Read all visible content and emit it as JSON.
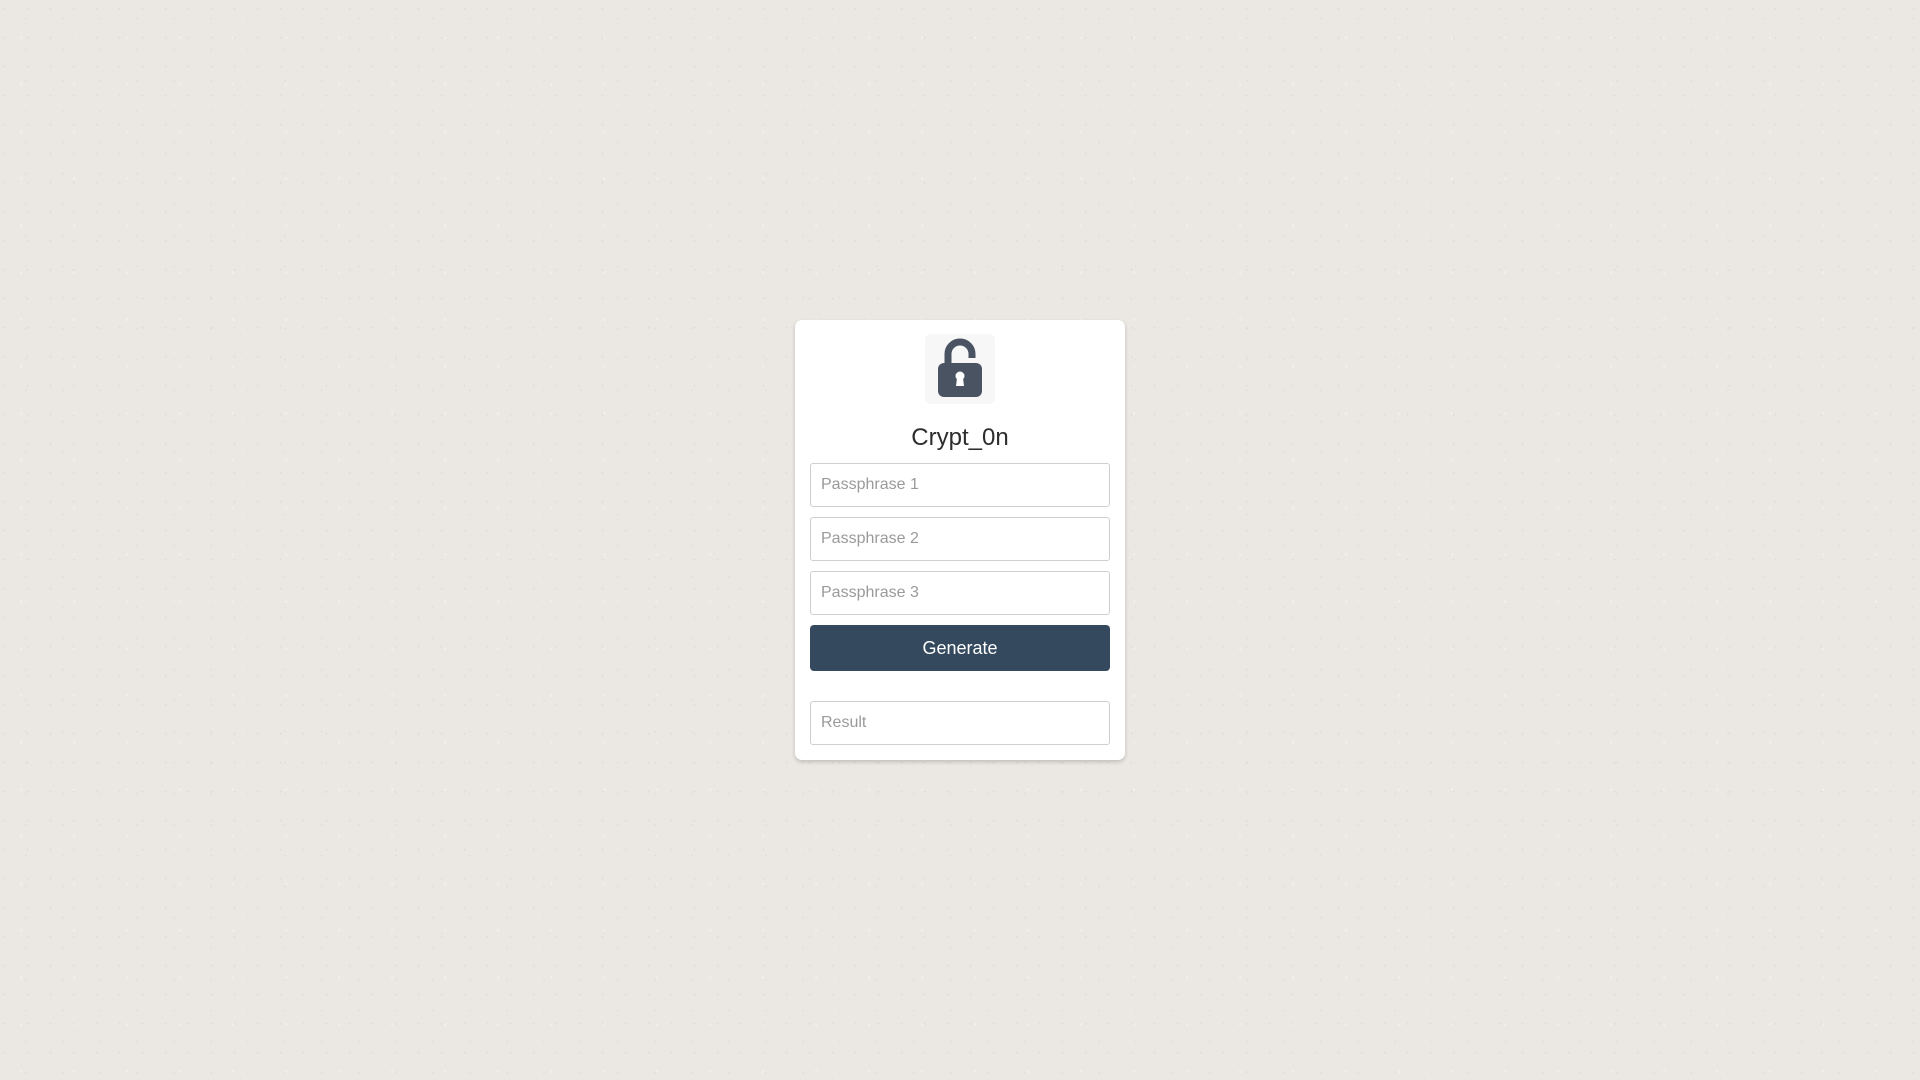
{
  "app": {
    "title": "Crypt_0n",
    "logo_icon": "unlocked-padlock-icon"
  },
  "form": {
    "passphrase1_placeholder": "Passphrase 1",
    "passphrase1_value": "",
    "passphrase2_placeholder": "Passphrase 2",
    "passphrase2_value": "",
    "passphrase3_placeholder": "Passphrase 3",
    "passphrase3_value": "",
    "generate_label": "Generate",
    "result_placeholder": "Result",
    "result_value": ""
  },
  "colors": {
    "background": "#ebe7e3",
    "card": "#ffffff",
    "button": "#34495e",
    "button_text": "#ffffff",
    "icon": "#4a5361"
  }
}
